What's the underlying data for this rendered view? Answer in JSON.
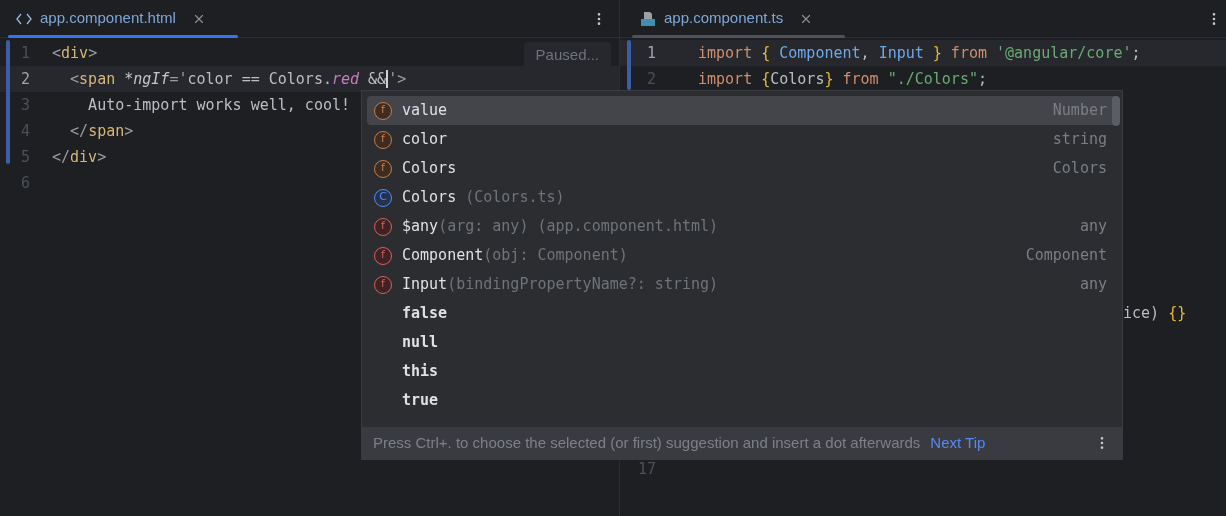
{
  "left_editor": {
    "tab": {
      "label": "app.component.html",
      "selected": true
    },
    "lines": [
      {
        "number": "1",
        "current": false,
        "tokens": [
          {
            "text": "<",
            "kind": "bracket"
          },
          {
            "text": "div",
            "kind": "tag"
          },
          {
            "text": ">",
            "kind": "bracket"
          }
        ]
      },
      {
        "number": "2",
        "current": true,
        "tokens": [
          {
            "text": "  <",
            "kind": "bracket"
          },
          {
            "text": "span ",
            "kind": "tag"
          },
          {
            "text": "*ngIf",
            "kind": "directive"
          },
          {
            "text": "='",
            "kind": "bracket"
          },
          {
            "text": "color == Colors.",
            "kind": "plain"
          },
          {
            "text": "red",
            "kind": "member"
          },
          {
            "text": " &&",
            "kind": "plain"
          },
          {
            "text": "'>",
            "kind": "bracket"
          }
        ]
      },
      {
        "number": "3",
        "current": false,
        "tokens": [
          {
            "text": "    Auto-import works well, cool!",
            "kind": "plain"
          }
        ]
      },
      {
        "number": "4",
        "current": false,
        "tokens": [
          {
            "text": "  </",
            "kind": "bracket"
          },
          {
            "text": "span",
            "kind": "tag"
          },
          {
            "text": ">",
            "kind": "bracket"
          }
        ]
      },
      {
        "number": "5",
        "current": false,
        "tokens": [
          {
            "text": "</",
            "kind": "bracket"
          },
          {
            "text": "div",
            "kind": "tag"
          },
          {
            "text": ">",
            "kind": "bracket"
          }
        ]
      },
      {
        "number": "6",
        "current": false
      }
    ],
    "status_hint": "Paused..."
  },
  "right_editor": {
    "tab": {
      "label": "app.component.ts",
      "selected": false
    },
    "lines": [
      {
        "number": "1",
        "current": true,
        "tokens": [
          {
            "text": "import ",
            "kind": "keyword"
          },
          {
            "text": "{ ",
            "kind": "brace"
          },
          {
            "text": "Component",
            "kind": "class"
          },
          {
            "text": ", ",
            "kind": "plain"
          },
          {
            "text": "Input",
            "kind": "class"
          },
          {
            "text": " }",
            "kind": "brace"
          },
          {
            "text": " from ",
            "kind": "keyword"
          },
          {
            "text": "'@angular/core'",
            "kind": "string"
          },
          {
            "text": ";",
            "kind": "plain"
          }
        ]
      },
      {
        "number": "2",
        "current": false,
        "tokens": [
          {
            "text": "import ",
            "kind": "keyword"
          },
          {
            "text": "{",
            "kind": "brace"
          },
          {
            "text": "Colors",
            "kind": "plain"
          },
          {
            "text": "}",
            "kind": "brace"
          },
          {
            "text": " from ",
            "kind": "keyword"
          },
          {
            "text": "\"./Colors\"",
            "kind": "string"
          },
          {
            "text": ";",
            "kind": "plain"
          }
        ]
      }
    ],
    "partial_line": {
      "tokens": [
        {
          "text": "ice) ",
          "kind": "plain"
        },
        {
          "text": "{}",
          "kind": "brace"
        }
      ]
    },
    "last_line_number": "17"
  },
  "completion_popup": {
    "items": [
      {
        "kind": "property",
        "badge": "f",
        "name": "value",
        "type": "Number",
        "selected": true
      },
      {
        "kind": "property",
        "badge": "f",
        "name": "color",
        "type": "string",
        "selected": false
      },
      {
        "kind": "property",
        "badge": "f",
        "name": "Colors",
        "type": "Colors",
        "selected": false
      },
      {
        "kind": "class",
        "badge": "C",
        "name": "Colors",
        "detail": " (Colors.ts)",
        "selected": false
      },
      {
        "kind": "function",
        "badge": "f",
        "name": "$any",
        "detail": "(arg: any) (app.component.html)",
        "type": "any",
        "selected": false
      },
      {
        "kind": "function",
        "badge": "f",
        "name": "Component",
        "detail": "(obj: Component)",
        "type": "Component",
        "selected": false
      },
      {
        "kind": "function",
        "badge": "f",
        "name": "Input",
        "detail": "(bindingPropertyName?: string)",
        "type": "any",
        "selected": false
      },
      {
        "kind": "keyword",
        "name": "false",
        "selected": false
      },
      {
        "kind": "keyword",
        "name": "null",
        "selected": false
      },
      {
        "kind": "keyword",
        "name": "this",
        "selected": false
      },
      {
        "kind": "keyword",
        "name": "true",
        "selected": false
      }
    ],
    "tip": "Press Ctrl+. to choose the selected (or first) suggestion and insert a dot afterwards",
    "tip_link": "Next Tip"
  }
}
